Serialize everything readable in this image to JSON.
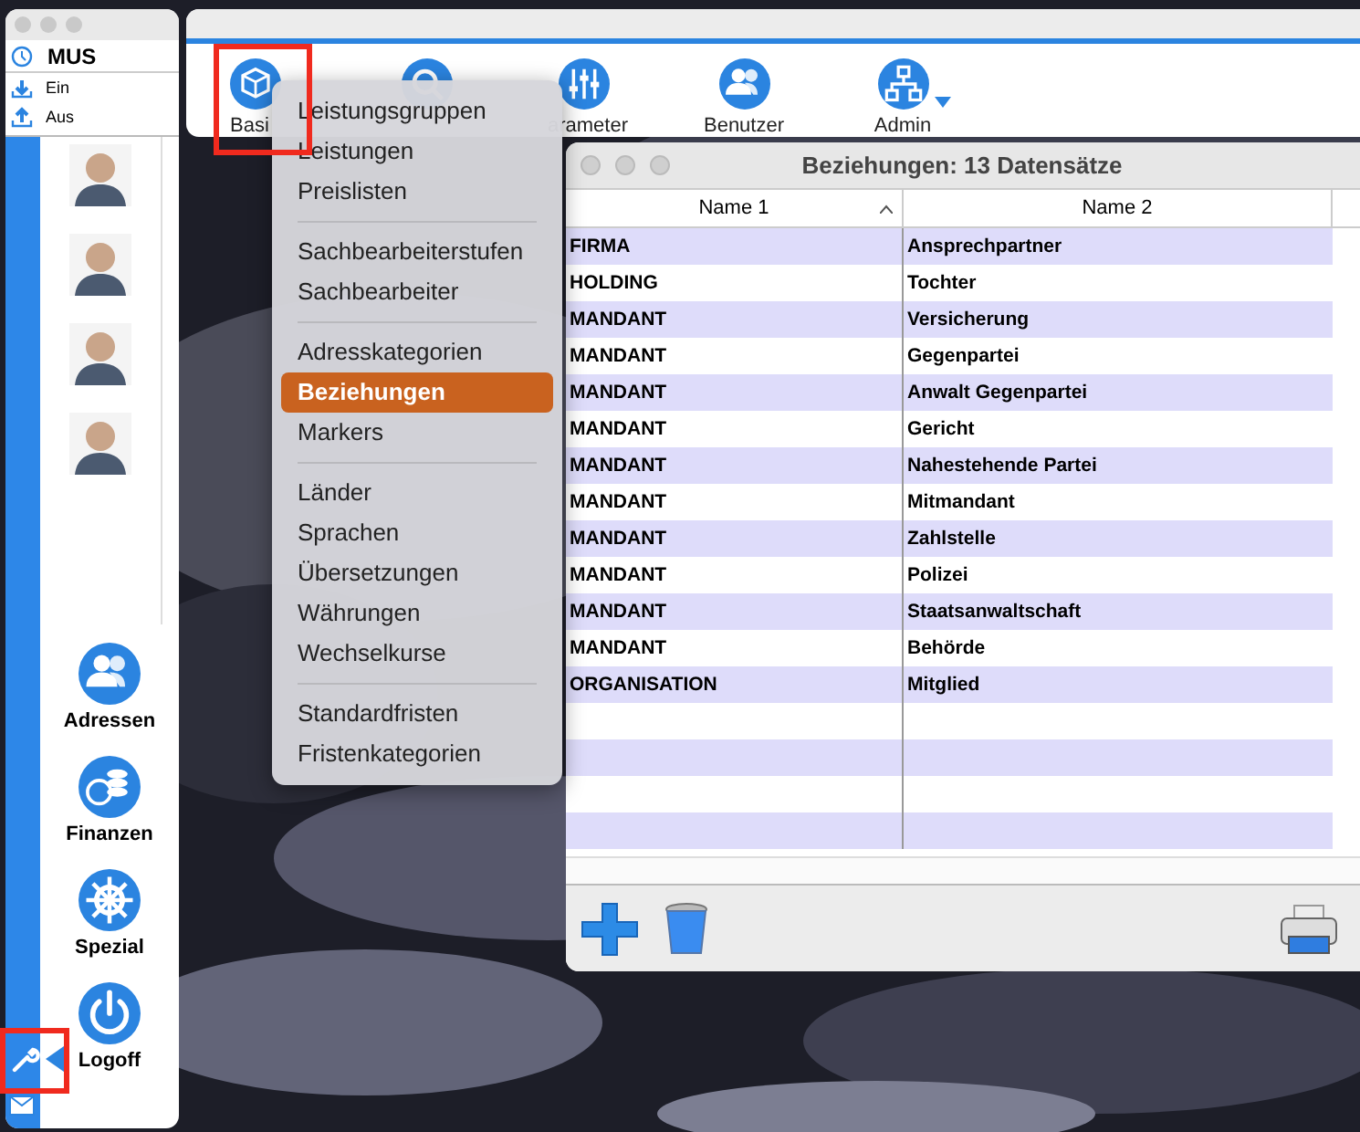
{
  "sidebar_window": {
    "account": "MUS",
    "actions": [
      {
        "label": "Ein",
        "kind": "in"
      },
      {
        "label": "Aus",
        "kind": "out"
      }
    ],
    "contacts": [
      {
        "kind": "avatar"
      },
      {
        "kind": "avatar"
      },
      {
        "kind": "avatar"
      },
      {
        "kind": "avatar"
      }
    ],
    "modules": [
      {
        "label": "Adressen",
        "kind": "people"
      },
      {
        "label": "Finanzen",
        "kind": "coins"
      },
      {
        "label": "Spezial",
        "kind": "wheel"
      },
      {
        "label": "Logoff",
        "kind": "power"
      }
    ]
  },
  "toolbar": {
    "items": [
      {
        "label": "Basi",
        "kind": "box"
      },
      {
        "kind": "search"
      },
      {
        "label": "arameter",
        "kind": "sliders"
      },
      {
        "label": "Benutzer",
        "kind": "people"
      },
      {
        "label": "Admin",
        "kind": "network",
        "dropdown": true
      }
    ]
  },
  "menu": {
    "groups": [
      {
        "items": [
          {
            "label": "Leistungsgruppen",
            "selected": false
          },
          {
            "label": "Leistungen",
            "selected": false
          },
          {
            "label": "Preislisten",
            "selected": false
          }
        ]
      },
      {
        "items": [
          {
            "label": "Sachbearbeiterstufen",
            "selected": false
          },
          {
            "label": "Sachbearbeiter",
            "selected": false
          }
        ]
      },
      {
        "items": [
          {
            "label": "Adresskategorien",
            "selected": false
          },
          {
            "label": "Beziehungen",
            "selected": true
          },
          {
            "label": "Markers",
            "selected": false
          }
        ]
      },
      {
        "items": [
          {
            "label": "Länder",
            "selected": false
          },
          {
            "label": "Sprachen",
            "selected": false
          },
          {
            "label": "Übersetzungen",
            "selected": false
          },
          {
            "label": "Währungen",
            "selected": false
          },
          {
            "label": "Wechselkurse",
            "selected": false
          }
        ]
      },
      {
        "items": [
          {
            "label": "Standardfristen",
            "selected": false
          },
          {
            "label": "Fristenkategorien",
            "selected": false
          }
        ]
      }
    ]
  },
  "table_window": {
    "title": "Beziehungen: 13 Datensätze",
    "columns": [
      {
        "label": "Name 1",
        "sorted": true
      },
      {
        "label": "Name 2",
        "sorted": false
      }
    ],
    "rows": [
      [
        "FIRMA",
        "Ansprechpartner"
      ],
      [
        "HOLDING",
        "Tochter"
      ],
      [
        "MANDANT",
        "Versicherung"
      ],
      [
        "MANDANT",
        "Gegenpartei"
      ],
      [
        "MANDANT",
        "Anwalt Gegenpartei"
      ],
      [
        "MANDANT",
        "Gericht"
      ],
      [
        "MANDANT",
        "Nahestehende Partei"
      ],
      [
        "MANDANT",
        "Mitmandant"
      ],
      [
        "MANDANT",
        "Zahlstelle"
      ],
      [
        "MANDANT",
        "Polizei"
      ],
      [
        "MANDANT",
        "Staatsanwaltschaft"
      ],
      [
        "MANDANT",
        "Behörde"
      ],
      [
        "ORGANISATION",
        "Mitglied"
      ]
    ],
    "actions": [
      {
        "kind": "add"
      },
      {
        "kind": "delete"
      },
      {
        "kind": "print"
      }
    ]
  }
}
